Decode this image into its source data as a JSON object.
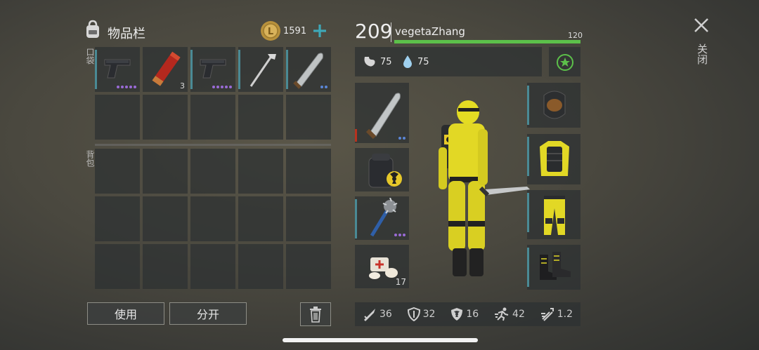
{
  "inventory": {
    "title": "物品栏",
    "coins": "1591",
    "pocket_label": "口袋",
    "backpack_label": "背包",
    "pocket_items": [
      {
        "name": "pistol",
        "count": "",
        "dots": [
          "#9a6bd6",
          "#9a6bd6",
          "#9a6bd6",
          "#9a6bd6",
          "#9a6bd6"
        ]
      },
      {
        "name": "flare",
        "count": "3",
        "dots": []
      },
      {
        "name": "pistol",
        "count": "",
        "dots": [
          "#9a6bd6",
          "#9a6bd6",
          "#9a6bd6",
          "#9a6bd6",
          "#9a6bd6"
        ]
      },
      {
        "name": "hoe",
        "count": "",
        "dots": []
      },
      {
        "name": "machete",
        "count": "",
        "dots": [
          "#5b86d6",
          "#5b86d6"
        ]
      }
    ],
    "use_button": "使用",
    "split_button": "分开"
  },
  "character": {
    "level": "209",
    "name": "vegetaZhang",
    "health_max": "120",
    "health_fraction": 1.0,
    "food": "75",
    "water": "75"
  },
  "equipment": {
    "weapon_count": "",
    "medkit_count": "17"
  },
  "stats": [
    {
      "icon": "sword-icon",
      "value": "36"
    },
    {
      "icon": "shield-icon",
      "value": "32"
    },
    {
      "icon": "radiation-shield-icon",
      "value": "16"
    },
    {
      "icon": "run-icon",
      "value": "42"
    },
    {
      "icon": "speed-icon",
      "value": "1.2"
    }
  ],
  "close_label": "关闭",
  "colors": {
    "accent": "#3ea8b8",
    "health": "#5cc04a",
    "rarity_purple": "#9a6bd6",
    "rarity_blue": "#5b86d6"
  }
}
